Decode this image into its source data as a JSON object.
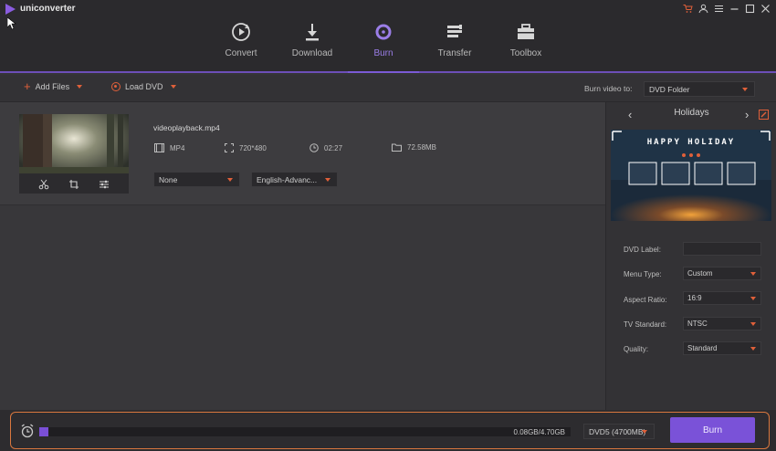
{
  "app": {
    "title": "uniconverter"
  },
  "nav": {
    "tabs": [
      {
        "label": "Convert"
      },
      {
        "label": "Download"
      },
      {
        "label": "Burn"
      },
      {
        "label": "Transfer"
      },
      {
        "label": "Toolbox"
      }
    ],
    "active_index": 2
  },
  "toolbar": {
    "add_files_label": "Add Files",
    "load_dvd_label": "Load DVD",
    "burn_to_label": "Burn video to:",
    "burn_to_value": "DVD Folder"
  },
  "file": {
    "name": "videoplayback.mp4",
    "format": "MP4",
    "resolution": "720*480",
    "duration": "02:27",
    "size": "72.58MB",
    "subtitle_value": "None",
    "audio_value": "English-Advanc..."
  },
  "panel": {
    "template_name": "Holidays",
    "template_title": "HAPPY HOLIDAY",
    "fields": {
      "dvd_label": "DVD Label:",
      "menu_type": "Menu Type:",
      "menu_type_value": "Custom",
      "aspect_ratio": "Aspect Ratio:",
      "aspect_ratio_value": "16:9",
      "tv_standard": "TV Standard:",
      "tv_standard_value": "NTSC",
      "quality": "Quality:",
      "quality_value": "Standard"
    }
  },
  "bottom": {
    "progress_text": "0.08GB/4.70GB",
    "progress_fraction": 0.017,
    "disc_type": "DVD5 (4700MB)",
    "burn_label": "Burn"
  },
  "colors": {
    "accent": "#7a52d8",
    "orange": "#e0603a"
  }
}
